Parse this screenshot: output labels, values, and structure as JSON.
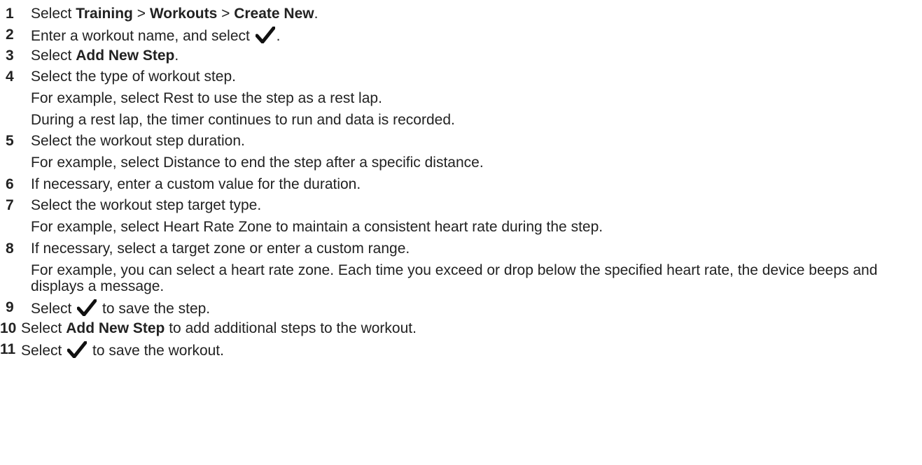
{
  "steps": [
    {
      "num": "1",
      "t1": "Select ",
      "b1": "Training",
      "t2": " > ",
      "b2": "Workouts",
      "t3": " > ",
      "b3": "Create New",
      "t4": "."
    },
    {
      "num": "2",
      "t1": "Enter a workout name, and select ",
      "icon": "checkmark-icon",
      "t2": "."
    },
    {
      "num": "3",
      "t1": "Select ",
      "b1": "Add New Step",
      "t2": "."
    },
    {
      "num": "4",
      "text": "Select the type of workout step.",
      "sub1": "For example, select Rest to use the step as a rest lap.",
      "sub2": "During a rest lap, the timer continues to run and data is recorded."
    },
    {
      "num": "5",
      "text": "Select the workout step duration.",
      "sub1": "For example, select Distance to end the step after a specific distance."
    },
    {
      "num": "6",
      "text": "If necessary, enter a custom value for the duration."
    },
    {
      "num": "7",
      "text": "Select the workout step target type.",
      "sub1": "For example, select Heart Rate Zone to maintain a consistent heart rate during the step."
    },
    {
      "num": "8",
      "text": "If necessary, select a target zone or enter a custom range.",
      "sub1": "For example, you can select a heart rate zone. Each time you exceed or drop below the specified heart rate, the device beeps and displays a message."
    },
    {
      "num": "9",
      "t1": "Select ",
      "icon": "checkmark-icon",
      "t2": " to save the step."
    },
    {
      "num": "10",
      "t1": "Select ",
      "b1": "Add New Step",
      "t2": " to add additional steps to the workout."
    },
    {
      "num": "11",
      "t1": "Select ",
      "icon": "checkmark-icon",
      "t2": " to save the workout."
    }
  ]
}
